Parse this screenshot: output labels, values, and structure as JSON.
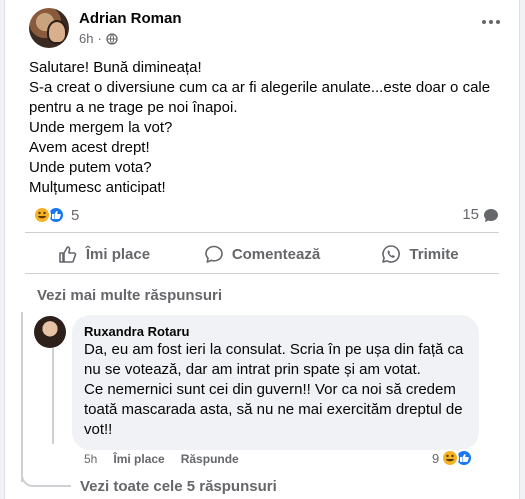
{
  "post": {
    "author": "Adrian Roman",
    "time": "6h",
    "dot": "·",
    "lines": [
      "Salutare! Bună dimineața!",
      "S-a creat o diversiune cum ca ar fi alegerile anulate...este doar o cale pentru a ne trage pe noi înapoi.",
      "Unde mergem la vot?",
      "Avem acest drept!",
      "Unde putem vota?",
      "Mulțumesc anticipat!"
    ],
    "reaction_count": "5",
    "comment_count": "15",
    "reaction_icons": [
      "haha-emoji-icon",
      "like-icon"
    ]
  },
  "actions": {
    "like": "Îmi place",
    "comment": "Comentează",
    "share": "Trimite"
  },
  "more_replies": "Vezi mai multe răspunsuri",
  "comment": {
    "author": "Ruxandra Rotaru",
    "lines": [
      "Da, eu am fost ieri la consulat. Scria în pe ușa din față ca nu se votează, dar am intrat prin spate și am votat.",
      "Ce nemernici sunt cei din guvern!! Vor ca noi să credem toată mascarada asta, să nu ne mai exercităm dreptul de vot!!"
    ],
    "time": "5h",
    "like": "Îmi place",
    "reply": "Răspunde",
    "reaction_count": "9"
  },
  "all_replies": "Vezi toate cele 5 răspunsuri",
  "colors": {
    "text": "#050505",
    "secondary": "#65676b",
    "like_blue": "#1877f2",
    "haha_yellow": "#f7b125",
    "bubble": "#f0f2f5"
  }
}
